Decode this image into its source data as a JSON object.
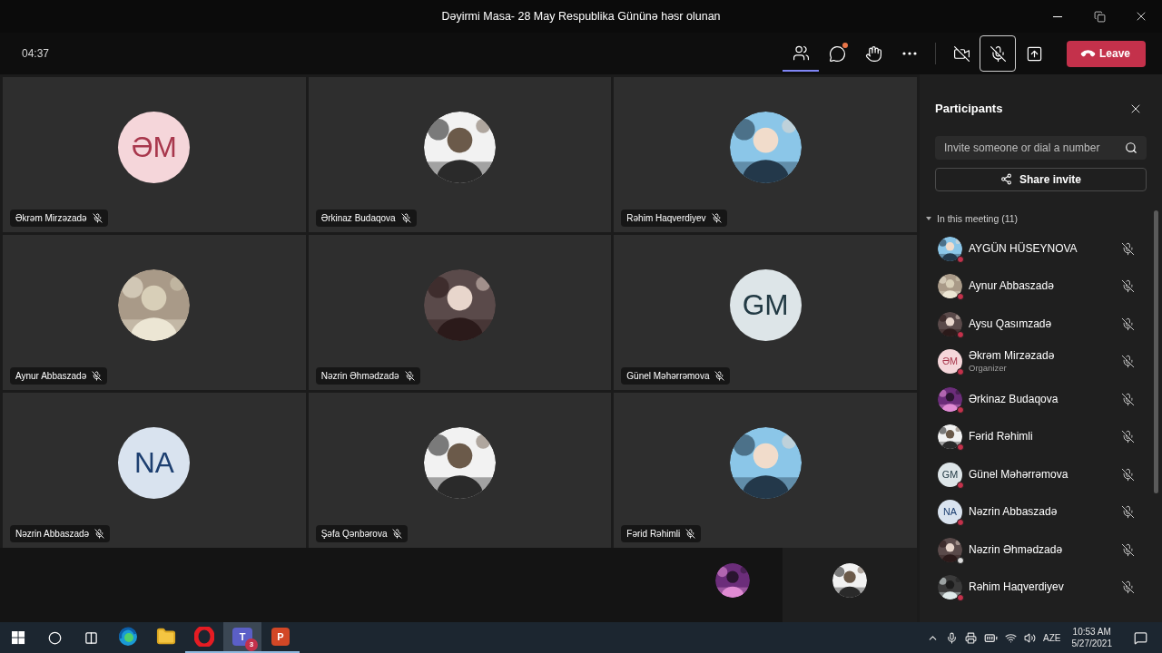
{
  "window": {
    "title": "Dəyirmi Masa- 28 May Respublika Gününə həsr olunan"
  },
  "toolbar": {
    "timer": "04:37",
    "buttons": [
      {
        "kind": "participants",
        "selected": true,
        "notification": false
      },
      {
        "kind": "chat",
        "selected": false,
        "notification": true
      },
      {
        "kind": "reactions",
        "selected": false,
        "notification": false
      },
      {
        "kind": "more",
        "selected": false,
        "notification": false
      },
      {
        "kind": "camera",
        "selected": false,
        "notification": false
      },
      {
        "kind": "mic",
        "selected": true,
        "notification": false
      },
      {
        "kind": "share",
        "selected": false,
        "notification": false
      }
    ],
    "leave": "Leave"
  },
  "tiles": [
    {
      "name": "Əkrəm Mirzəzadə",
      "avatar": {
        "kind": "initials",
        "text": "ƏM",
        "color": "#f5d6da"
      }
    },
    {
      "name": "Ərkinaz Budaqova"
    },
    {
      "name": "Rəhim Haqverdiyev"
    },
    {
      "name": "Aynur Abbaszadə"
    },
    {
      "name": "Nəzrin Əhmədzadə"
    },
    {
      "name": "Günel Məhərrəmova",
      "avatar": {
        "kind": "initials",
        "text": "GM",
        "color": "#dde5e8"
      }
    },
    {
      "name": "Nəzrin Abbaszadə",
      "avatar": {
        "kind": "initials",
        "text": "NA",
        "color": "#d9e3ef"
      }
    },
    {
      "name": "Şəfa Qənbərova"
    },
    {
      "name": "Fərid Rəhimli"
    }
  ],
  "participants_panel": {
    "title": "Participants",
    "search": {
      "placeholder": "Invite someone or dial a number"
    },
    "share_button": "Share invite",
    "section": "In this meeting (11)",
    "people": [
      {
        "name": "AYGÜN HÜSEYNOVA",
        "color": "#c4314b"
      },
      {
        "name": "Aynur Abbaszadə",
        "color": "#c4314b"
      },
      {
        "name": "Aysu Qasımzadə",
        "color": "#c4314b"
      },
      {
        "name": "Əkrəm Mirzəzadə",
        "role": "Organizer",
        "avatar": {
          "kind": "initials",
          "text": "ƏM",
          "color": "#f5d6da"
        },
        "color": "#c4314b"
      },
      {
        "name": "Ərkinaz Budaqova",
        "color": "#c4314b"
      },
      {
        "name": "Fərid Rəhimli",
        "color": "#c4314b"
      },
      {
        "name": "Günel Məhərrəmova",
        "avatar": {
          "kind": "initials",
          "text": "GM",
          "color": "#dde5e8"
        },
        "color": "#c4314b"
      },
      {
        "name": "Nəzrin Abbaszadə",
        "avatar": {
          "kind": "initials",
          "text": "NA",
          "color": "#d9e3ef"
        },
        "color": "#c4314b"
      },
      {
        "name": "Nəzrin Əhmədzadə",
        "color": "#dcdcdc"
      },
      {
        "name": "Rəhim Haqverdiyev",
        "color": "#c4314b"
      }
    ]
  },
  "taskbar": {
    "apps": [
      {
        "kind": "edge",
        "running": false,
        "selected": false
      },
      {
        "kind": "explorer",
        "running": false,
        "selected": false
      },
      {
        "kind": "opera",
        "running": true,
        "selected": false
      },
      {
        "kind": "teams",
        "glyph": "T",
        "badge": "3",
        "running": true,
        "selected": true
      },
      {
        "kind": "powerpoint",
        "glyph": "P",
        "running": true,
        "selected": false
      }
    ],
    "language": "AZE",
    "time": "10:53 AM",
    "date": "5/27/2021"
  }
}
